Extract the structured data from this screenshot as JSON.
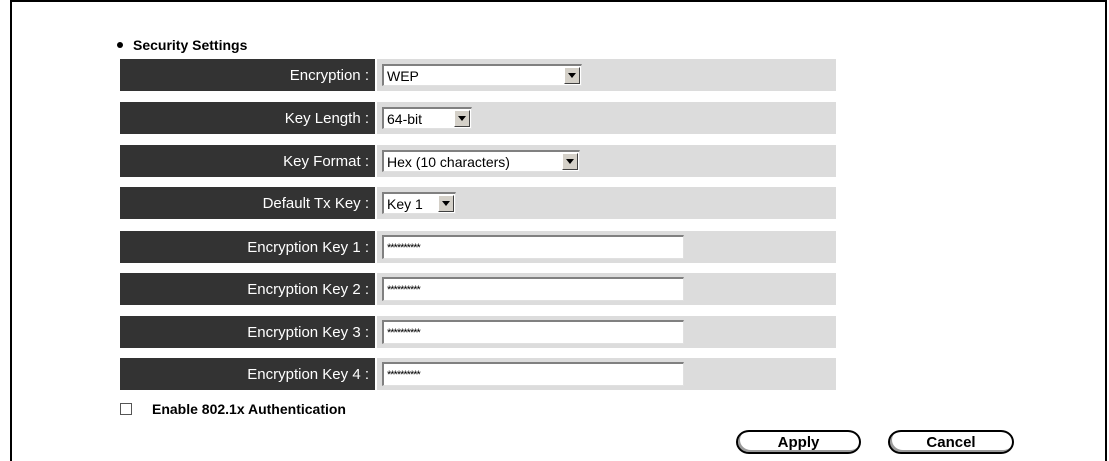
{
  "section": {
    "title": "Security Settings"
  },
  "fields": {
    "encryption": {
      "label": "Encryption :",
      "value": "WEP"
    },
    "key_length": {
      "label": "Key Length :",
      "value": "64-bit"
    },
    "key_format": {
      "label": "Key Format :",
      "value": "Hex (10 characters)"
    },
    "default_tx_key": {
      "label": "Default Tx Key :",
      "value": "Key 1"
    },
    "encryption_key_1": {
      "label": "Encryption Key 1 :",
      "value": "**********"
    },
    "encryption_key_2": {
      "label": "Encryption Key 2 :",
      "value": "**********"
    },
    "encryption_key_3": {
      "label": "Encryption Key 3 :",
      "value": "**********"
    },
    "encryption_key_4": {
      "label": "Encryption Key 4 :",
      "value": "**********"
    }
  },
  "checkbox": {
    "label": "Enable 802.1x Authentication",
    "checked": false
  },
  "buttons": {
    "apply": "Apply",
    "cancel": "Cancel"
  },
  "colors": {
    "label_bg": "#333333",
    "value_bg": "#dcdcdc"
  }
}
